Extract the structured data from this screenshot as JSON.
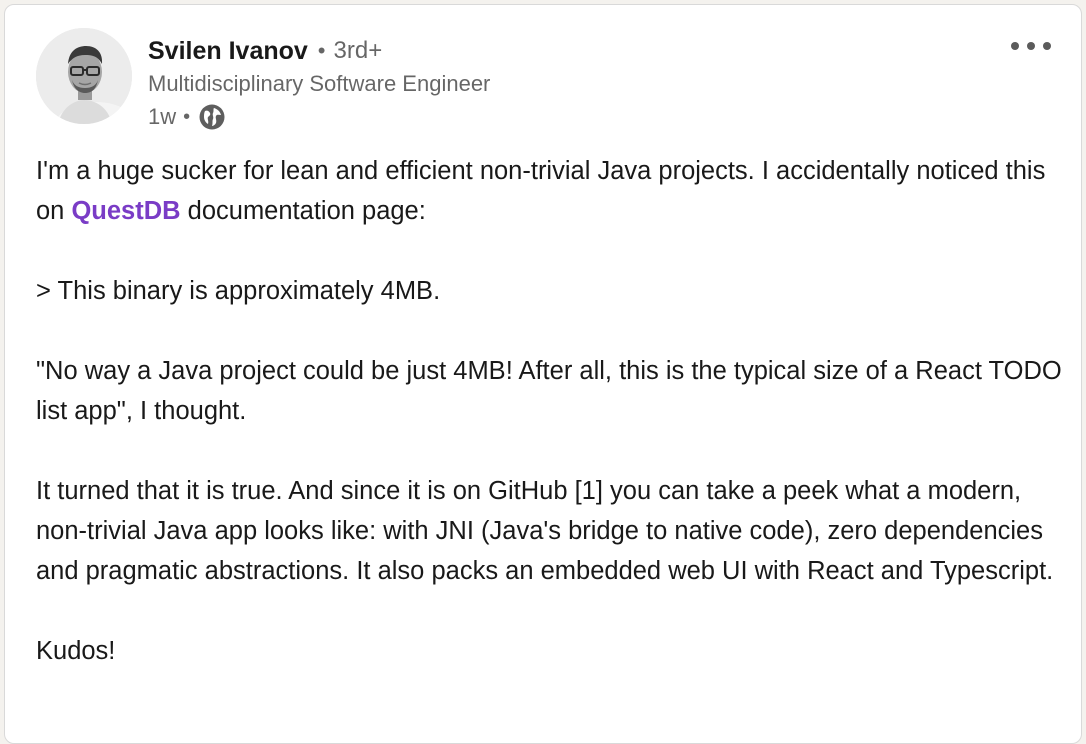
{
  "post": {
    "author": {
      "name": "Svilen Ivanov",
      "separator": "•",
      "degree": "3rd+",
      "headline": "Multidisciplinary Software Engineer",
      "time": "1w",
      "time_separator": "•",
      "visibility_icon": "globe-icon"
    },
    "menu_icon": "more-horizontal-icon",
    "body": {
      "p1_before": "I'm a huge sucker for lean and efficient non-trivial Java projects. I accidentally noticed this on ",
      "p1_mention": "QuestDB",
      "p1_after": " documentation page:",
      "p2": "> This binary is approximately 4MB.",
      "p3": "\"No way a Java project could be just 4MB! After all, this is the typical size of a React TODO list app\", I thought.",
      "p4": "It turned that it is true. And since it is on GitHub [1] you can take a peek what a modern, non-trivial Java app looks like: with JNI (Java's bridge to native code), zero dependencies and pragmatic abstractions. It also packs an embedded web UI with React and Typescript.",
      "p5": "Kudos!"
    },
    "colors": {
      "mention": "#7a3cc6",
      "text": "#1f1f1f",
      "muted": "#666666"
    }
  }
}
